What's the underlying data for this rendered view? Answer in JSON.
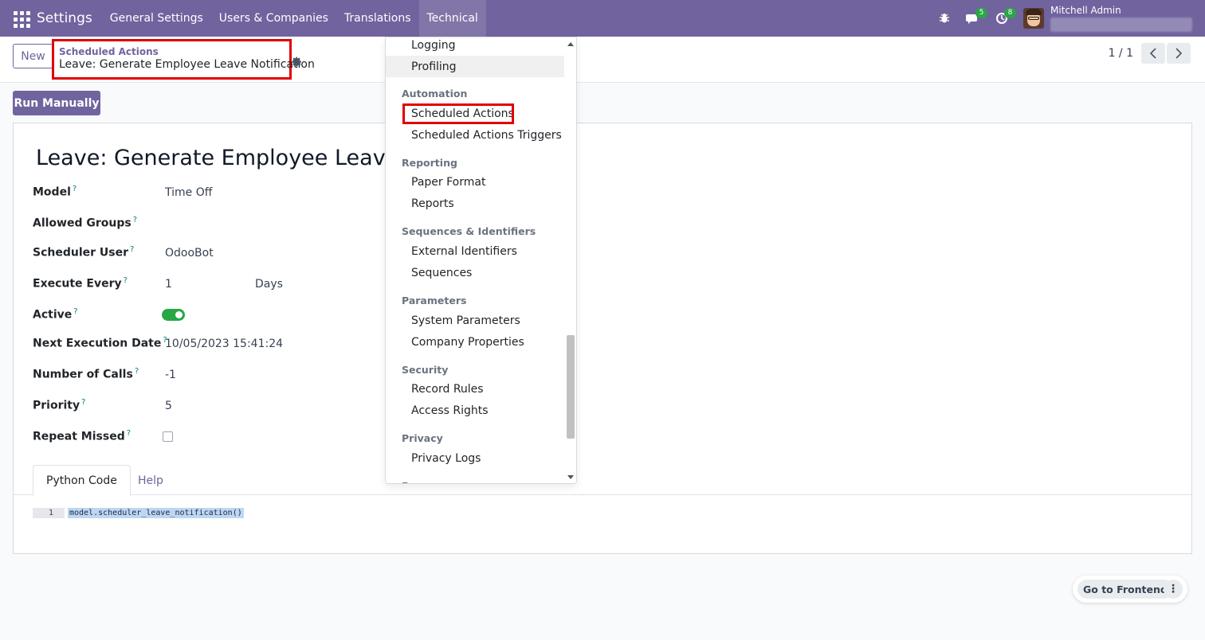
{
  "navbar": {
    "brand": "Settings",
    "menu": [
      "General Settings",
      "Users & Companies",
      "Translations",
      "Technical"
    ],
    "active_menu": "Technical",
    "messages_count": "5",
    "activities_count": "8",
    "user_name": "Mitchell Admin",
    "icons": [
      "apps-grid-icon",
      "bug-icon",
      "chat-icon",
      "clock-icon",
      "avatar"
    ],
    "accent_color": "#71639e"
  },
  "control_panel": {
    "new_label": "New",
    "breadcrumb_parent": "Scheduled Actions",
    "breadcrumb_current": "Leave: Generate Employee Leave Notification",
    "pager": "1 / 1"
  },
  "actions": {
    "run_manually": "Run Manually"
  },
  "form": {
    "title": "Leave: Generate Employee Leave N",
    "help_mark": "?",
    "fields": {
      "model": {
        "label": "Model",
        "value": "Time Off"
      },
      "allowed_groups": {
        "label": "Allowed Groups",
        "value": ""
      },
      "scheduler_user": {
        "label": "Scheduler User",
        "value": "OdooBot"
      },
      "execute_every": {
        "label": "Execute Every",
        "value": "1",
        "unit": "Days"
      },
      "active": {
        "label": "Active",
        "value": true
      },
      "next_execution": {
        "label": "Next Execution Date",
        "value": "10/05/2023 15:41:24"
      },
      "number_of_calls": {
        "label": "Number of Calls",
        "value": "-1"
      },
      "priority": {
        "label": "Priority",
        "value": "5"
      },
      "repeat_missed": {
        "label": "Repeat Missed",
        "value": false
      }
    },
    "tabs": [
      "Python Code",
      "Help"
    ],
    "code": {
      "line_number": "1",
      "text": "model.scheduler_leave_notification()"
    }
  },
  "dropdown": {
    "items_top": [
      "Logging",
      "Profiling"
    ],
    "hover_item": "Profiling",
    "sections": [
      {
        "header": "Automation",
        "items": [
          "Scheduled Actions",
          "Scheduled Actions Triggers"
        ]
      },
      {
        "header": "Reporting",
        "items": [
          "Paper Format",
          "Reports"
        ]
      },
      {
        "header": "Sequences & Identifiers",
        "items": [
          "External Identifiers",
          "Sequences"
        ]
      },
      {
        "header": "Parameters",
        "items": [
          "System Parameters",
          "Company Properties"
        ]
      },
      {
        "header": "Security",
        "items": [
          "Record Rules",
          "Access Rights"
        ]
      },
      {
        "header": "Privacy",
        "items": [
          "Privacy Logs"
        ]
      }
    ],
    "partial_header": "P",
    "highlighted": "Scheduled Actions"
  },
  "frontend": {
    "label": "Go to Frontend",
    "more": "⋮"
  },
  "colors": {
    "highlight_box": "#e00000",
    "toggle_on": "#28a745",
    "badge": "#28a745"
  }
}
